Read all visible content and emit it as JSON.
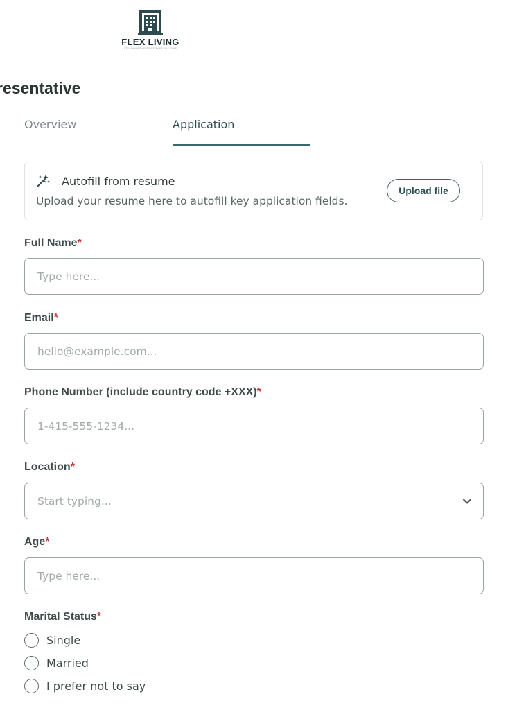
{
  "brand": {
    "name": "FLEX LIVING",
    "tagline": "STYLISH APARTMENTS & STAYING SOLUTIONS",
    "logo_icon": "building-icon"
  },
  "page": {
    "title": "resentative"
  },
  "tabs": [
    {
      "label": "Overview",
      "active": false
    },
    {
      "label": "Application",
      "active": true
    }
  ],
  "autofill": {
    "icon": "magic-wand-icon",
    "title": "Autofill from resume",
    "description": "Upload your resume here to autofill key application fields.",
    "upload_label": "Upload file"
  },
  "form": {
    "required_marker": "*",
    "full_name": {
      "label": "Full Name",
      "placeholder": "Type here..."
    },
    "email": {
      "label": "Email",
      "placeholder": "hello@example.com..."
    },
    "phone": {
      "label": "Phone Number (include country code +XXX)",
      "placeholder": "1-415-555-1234..."
    },
    "location": {
      "label": "Location",
      "placeholder": "Start typing...",
      "icon": "chevron-down-icon"
    },
    "age": {
      "label": "Age",
      "placeholder": "Type here..."
    },
    "marital_status": {
      "label": "Marital Status",
      "options": [
        "Single",
        "Married",
        "I prefer not to say"
      ]
    }
  },
  "colors": {
    "accent": "#2c4d51",
    "required": "#c63a3a",
    "border": "#9aa4a6",
    "placeholder": "#a3abab"
  }
}
